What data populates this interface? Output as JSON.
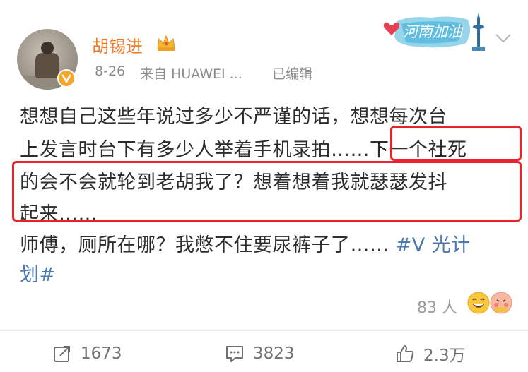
{
  "author": {
    "name": "胡锡进",
    "verified": true
  },
  "meta": {
    "date": "8-26",
    "source": "来自 HUAWEI ...",
    "edited": "已编辑"
  },
  "sticker": {
    "text": "河南加油"
  },
  "post": {
    "lines": [
      "想想自己这些年说过多少不严谨的话，想想每次台",
      "上发言时台下有多少人举着手机录拍……下一个社死",
      "的会不会就轮到老胡我了？想着想着我就瑟瑟发抖",
      "起来……",
      "师傅，厕所在哪？我憋不住要尿裤子了…… ",
      "划#"
    ],
    "hashtag_part": "#V 光计"
  },
  "reactions": {
    "count": "83 人"
  },
  "actions": {
    "repost": "1673",
    "comment": "3823",
    "like": "2.3万"
  },
  "colors": {
    "username": "#f07a28",
    "highlight_box": "#e8242a",
    "hashtag": "#4c7ab0",
    "meta_text": "#8d8d8d"
  }
}
